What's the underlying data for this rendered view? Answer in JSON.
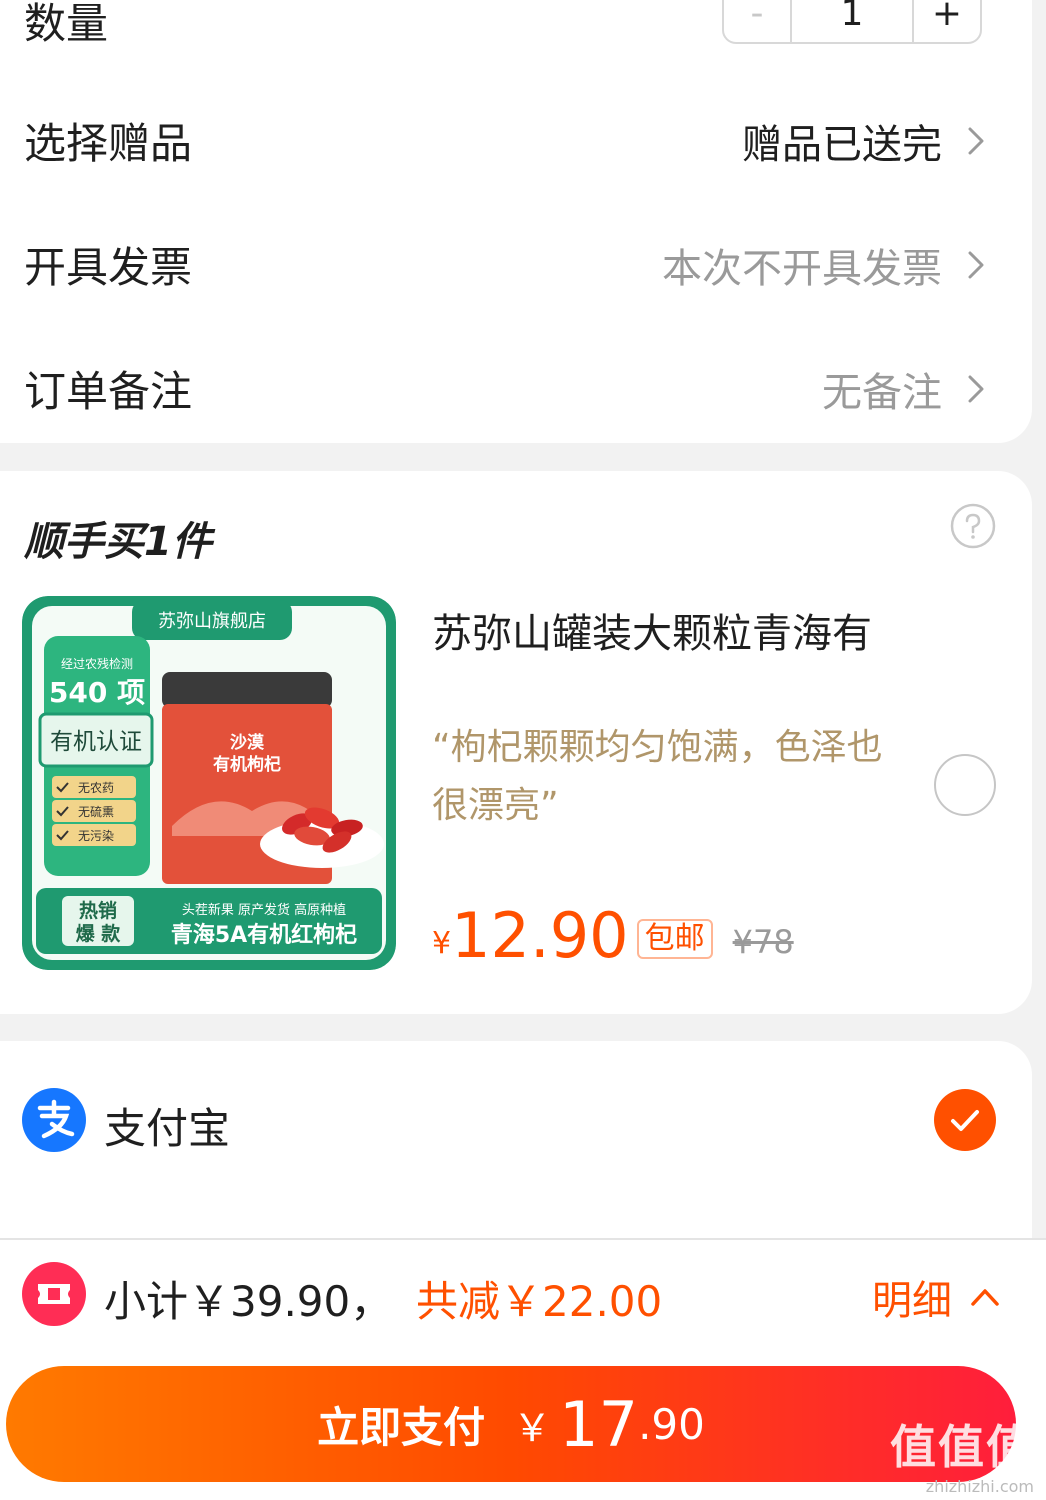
{
  "order": {
    "quantity_label": "数量",
    "quantity_value": "1",
    "minus": "-",
    "plus": "+",
    "gift_label": "选择赠品",
    "gift_value": "赠品已送完",
    "invoice_label": "开具发票",
    "invoice_value": "本次不开具发票",
    "remark_label": "订单备注",
    "remark_value": "无备注"
  },
  "addon": {
    "title": "顺手买1件",
    "image": {
      "shop": "苏弥山旗舰店",
      "check_text": "经过农残检测",
      "check_count": "540 项",
      "organic": "有机认证",
      "bullets": [
        "无农药",
        "无硫熏",
        "无污染"
      ],
      "can_title_1": "沙漠",
      "can_title_2": "有机枸杞",
      "hot_1": "热销",
      "hot_2": "爆 款",
      "tags": "头茬新果  原产发货  高原种植",
      "product_line": "青海5A有机红枸杞"
    },
    "product_name": "苏弥山罐装大颗粒青海有",
    "quote": "“枸杞颗颗均匀饱满，色泽也很漂亮”",
    "currency": "¥",
    "price": "12.90",
    "free_shipping": "包邮",
    "original_price": "¥78"
  },
  "payment": {
    "method": "支付宝"
  },
  "footer": {
    "subtotal": "小计￥39.90，",
    "discount": "共减￥22.00",
    "detail": "明细",
    "pay_label": "立即支付",
    "pay_currency": "￥",
    "pay_int": "17",
    "pay_dec": ".90"
  },
  "watermark": {
    "big": "值值值",
    "small": "zhizhizhi.com"
  },
  "colors": {
    "accent": "#ff5000",
    "quote": "#b0966a",
    "alipay": "#1677ff"
  }
}
